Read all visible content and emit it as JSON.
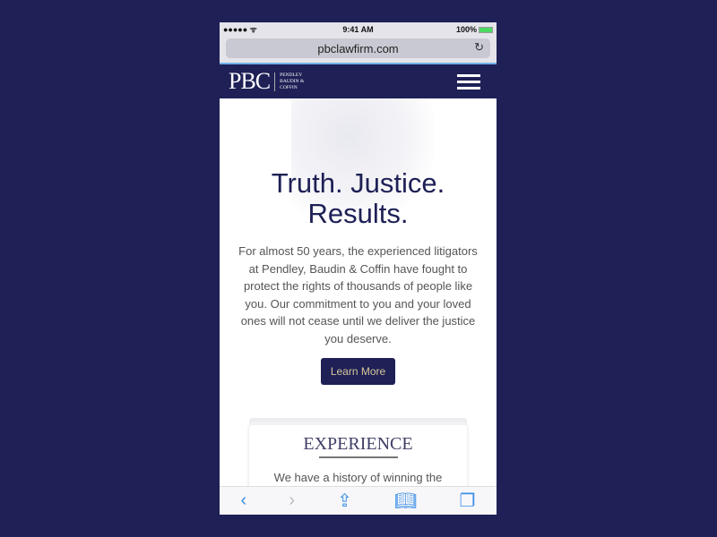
{
  "status": {
    "signal": "●●●●● ᯤ",
    "time": "9:41 AM",
    "battery": "100%"
  },
  "browser": {
    "url": "pbclawfirm.com"
  },
  "nav": {
    "logo_main": "PBC",
    "logo_sub": [
      "PENDLEY",
      "BAUDIN &",
      "COFFIN"
    ]
  },
  "hero": {
    "title_line1": "Truth. Justice.",
    "title_line2": "Results.",
    "description": "For almost 50 years, the experienced litigators at Pendley, Baudin & Coffin have fought to protect the rights of thousands of people like you. Our commitment to you and your loved ones will not cease until we deliver the justice you deserve.",
    "button": "Learn More"
  },
  "card": {
    "title": "EXPERIENCE",
    "text": "We have a history of winning the"
  },
  "colors": {
    "brand": "#1e2056",
    "button_text": "#d7c79a",
    "toolbar_icon": "#3b8ee8"
  }
}
